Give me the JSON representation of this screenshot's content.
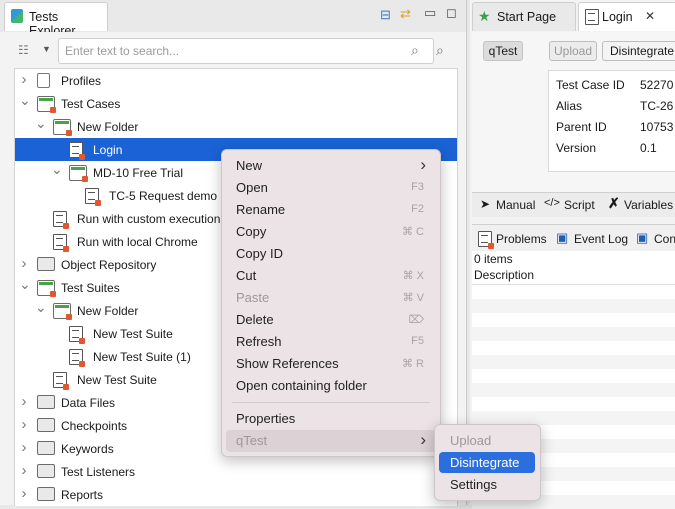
{
  "left_panel": {
    "tab_title": "Tests Explorer",
    "search_placeholder": "Enter text to search...",
    "tree": [
      {
        "label": "Profiles",
        "depth": 0,
        "expander": "collapsed",
        "icon": "profiles-icon"
      },
      {
        "label": "Test Cases",
        "depth": 0,
        "expander": "expanded",
        "icon": "folder-icon"
      },
      {
        "label": "New Folder",
        "depth": 1,
        "expander": "expanded",
        "icon": "folder-icon"
      },
      {
        "label": "Login",
        "depth": 2,
        "expander": "none",
        "icon": "test-case-icon",
        "selected": true
      },
      {
        "label": "MD-10 Free Trial",
        "depth": 2,
        "expander": "expanded",
        "icon": "folder-icon"
      },
      {
        "label": "TC-5 Request demo",
        "depth": 3,
        "expander": "none",
        "icon": "test-case-icon"
      },
      {
        "label": "Run with custom execution",
        "depth": 1,
        "expander": "none",
        "icon": "test-case-icon"
      },
      {
        "label": "Run with local Chrome",
        "depth": 1,
        "expander": "none",
        "icon": "test-case-icon"
      },
      {
        "label": "Object Repository",
        "depth": 0,
        "expander": "collapsed",
        "icon": "repository-icon"
      },
      {
        "label": "Test Suites",
        "depth": 0,
        "expander": "expanded",
        "icon": "folder-icon"
      },
      {
        "label": "New Folder",
        "depth": 1,
        "expander": "expanded",
        "icon": "folder-icon"
      },
      {
        "label": "New Test Suite",
        "depth": 2,
        "expander": "none",
        "icon": "test-suite-icon"
      },
      {
        "label": "New Test Suite (1)",
        "depth": 2,
        "expander": "none",
        "icon": "test-suite-icon"
      },
      {
        "label": "New Test Suite",
        "depth": 1,
        "expander": "none",
        "icon": "test-suite-icon"
      },
      {
        "label": "Data Files",
        "depth": 0,
        "expander": "collapsed",
        "icon": "data-files-icon"
      },
      {
        "label": "Checkpoints",
        "depth": 0,
        "expander": "collapsed",
        "icon": "checkpoints-icon"
      },
      {
        "label": "Keywords",
        "depth": 0,
        "expander": "collapsed",
        "icon": "keywords-icon"
      },
      {
        "label": "Test Listeners",
        "depth": 0,
        "expander": "collapsed",
        "icon": "listeners-icon"
      },
      {
        "label": "Reports",
        "depth": 0,
        "expander": "collapsed",
        "icon": "reports-icon"
      }
    ]
  },
  "right_panel": {
    "tabs": [
      {
        "label": "Start Page",
        "icon": "star-icon"
      },
      {
        "label": "Login",
        "icon": "test-case-icon",
        "active": true
      }
    ],
    "qtest_label": "qTest",
    "upload_label": "Upload",
    "disintegrate_label": "Disintegrate",
    "info": [
      {
        "key": "Test Case ID",
        "value": "52270"
      },
      {
        "key": "Alias",
        "value": "TC-26"
      },
      {
        "key": "Parent ID",
        "value": "10753"
      },
      {
        "key": "Version",
        "value": "0.1"
      }
    ],
    "editor_tabs": [
      "Manual",
      "Script",
      "Variables"
    ],
    "bottom_tabs": [
      "Problems",
      "Event Log",
      "Con"
    ],
    "items_count": "0 items",
    "column_header": "Description"
  },
  "context_menu": {
    "groups": [
      [
        {
          "label": "New",
          "submenu": true
        },
        {
          "label": "Open",
          "shortcut": "F3"
        },
        {
          "label": "Rename",
          "shortcut": "F2"
        },
        {
          "label": "Copy",
          "shortcut": "⌘ C"
        },
        {
          "label": "Copy ID"
        },
        {
          "label": "Cut",
          "shortcut": "⌘ X"
        },
        {
          "label": "Paste",
          "shortcut": "⌘ V",
          "disabled": true
        },
        {
          "label": "Delete",
          "shortcut": "⌦"
        },
        {
          "label": "Refresh",
          "shortcut": "F5"
        },
        {
          "label": "Show References",
          "shortcut": "⌘ R"
        },
        {
          "label": "Open containing folder"
        }
      ],
      [
        {
          "label": "Properties"
        },
        {
          "label": "qTest",
          "submenu": true,
          "disabled": true,
          "highlighted": true
        }
      ]
    ]
  },
  "qtest_submenu": [
    {
      "label": "Upload",
      "disabled": true
    },
    {
      "label": "Disintegrate",
      "selected": true
    },
    {
      "label": "Settings"
    }
  ],
  "colors": {
    "selection": "#1a62d6",
    "menu_background": "#ece3e6",
    "submenu_selection": "#2a6fdd"
  }
}
